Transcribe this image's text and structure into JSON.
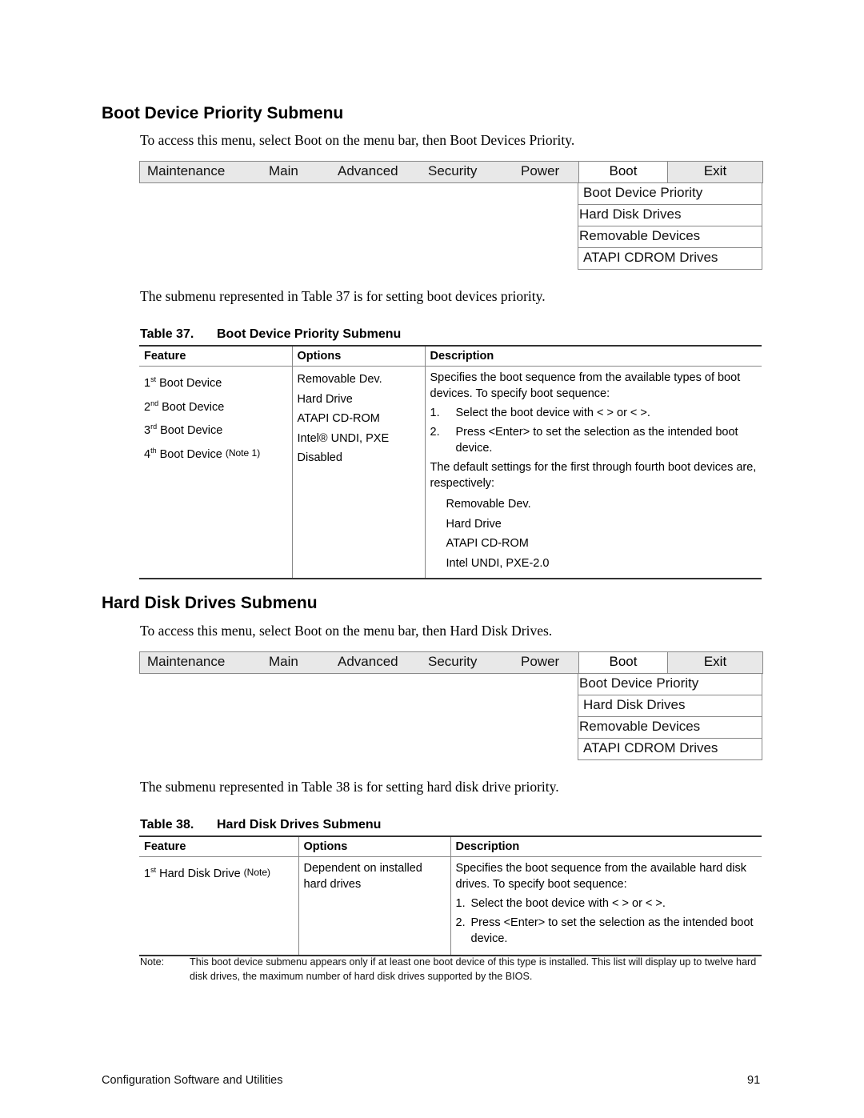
{
  "section1": {
    "heading": "Boot Device Priority Submenu",
    "intro": "To access this menu, select Boot on the menu bar, then Boot Devices Priority.",
    "menubar": [
      "Maintenance",
      "Main",
      "Advanced",
      "Security",
      "Power",
      "Boot",
      "Exit"
    ],
    "dropdown": [
      "Boot Device Priority",
      "Hard Disk Drives",
      "Removable Devices",
      "ATAPI CDROM Drives"
    ],
    "selected_item": "Boot Device Priority",
    "after_text": "The submenu represented in Table 37 is for setting boot devices priority.",
    "table": {
      "caption_num": "Table 37.",
      "caption_title": "Boot Device Priority Submenu",
      "headers": [
        "Feature",
        "Options",
        "Description"
      ],
      "features": [
        {
          "num": "1",
          "ord": "st",
          "label": "Boot Device",
          "note": ""
        },
        {
          "num": "2",
          "ord": "nd",
          "label": "Boot Device",
          "note": ""
        },
        {
          "num": "3",
          "ord": "rd",
          "label": "Boot Device",
          "note": ""
        },
        {
          "num": "4",
          "ord": "th",
          "label": "Boot Device",
          "note": "(Note 1)"
        }
      ],
      "options": [
        "Removable Dev.",
        "Hard Drive",
        "ATAPI CD-ROM",
        "Intel® UNDI, PXE",
        "Disabled"
      ],
      "description": {
        "intro": "Specifies the boot sequence from the available types of boot devices. To specify boot sequence:",
        "steps": [
          {
            "n": "1.",
            "text": "Select the boot device with <  > or <  >."
          },
          {
            "n": "2.",
            "text": "Press <Enter> to set the selection as the intended boot device."
          }
        ],
        "defaults_intro": "The default settings for the first through fourth boot devices are, respectively:",
        "defaults": [
          "Removable Dev.",
          "Hard Drive",
          "ATAPI CD-ROM",
          "Intel UNDI, PXE-2.0"
        ]
      }
    }
  },
  "section2": {
    "heading": "Hard Disk Drives Submenu",
    "intro": "To access this menu, select Boot on the menu bar, then Hard Disk Drives.",
    "menubar": [
      "Maintenance",
      "Main",
      "Advanced",
      "Security",
      "Power",
      "Boot",
      "Exit"
    ],
    "dropdown": [
      "Boot Device Priority",
      "Hard Disk Drives",
      "Removable Devices",
      "ATAPI CDROM Drives"
    ],
    "selected_item": "Hard Disk Drives",
    "after_text": "The submenu represented in Table 38 is for setting hard disk drive priority.",
    "table": {
      "caption_num": "Table 38.",
      "caption_title": "Hard Disk Drives Submenu",
      "headers": [
        "Feature",
        "Options",
        "Description"
      ],
      "feature": {
        "num": "1",
        "ord": "st",
        "label": "Hard Disk Drive",
        "note": "(Note)"
      },
      "options": "Dependent on installed hard drives",
      "description": {
        "intro": "Specifies the boot sequence from the available hard disk drives. To specify boot sequence:",
        "steps": [
          {
            "n": "1.",
            "text": "Select the boot device with <  > or <  >."
          },
          {
            "n": "2.",
            "text": "Press <Enter> to set the selection as the intended boot device."
          }
        ]
      }
    },
    "note_label": "Note:",
    "note_text": "This boot device submenu appears only if at least one boot device of this type is installed. This list will display up to twelve hard disk drives, the maximum number of hard disk drives supported by the BIOS."
  },
  "footer": {
    "left": "Configuration Software and Utilities",
    "page": "91"
  }
}
